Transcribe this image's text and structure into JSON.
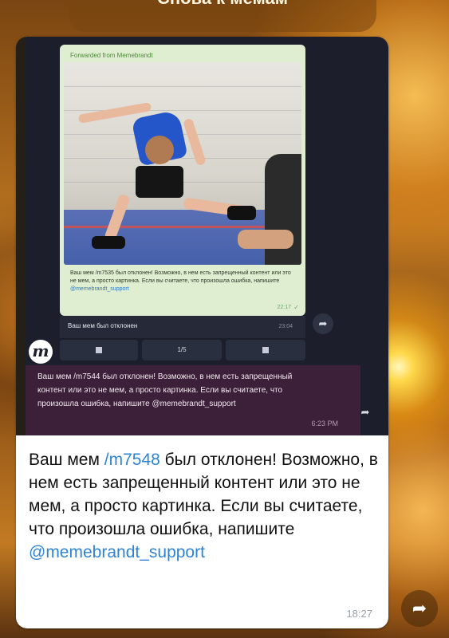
{
  "top_button": {
    "label": "Снова к мемам"
  },
  "screenshot": {
    "forwarded_label": "Forwarded from Memebrandt",
    "photo_caption": {
      "pre": "Ваш мем ",
      "cmd": "/m7535",
      "mid": " был отклонен! Возможно, в нем есть запрещенный контент или это не мем, а просто картинка. Если вы считаете, что произошла ошибка, напишите ",
      "handle": "@memebrandt_support",
      "time": "22:17"
    },
    "bot_message": {
      "text": "Ваш мем был отклонен",
      "time": "23:04"
    },
    "pager": {
      "page": "1/5"
    },
    "rejection": {
      "text": "Ваш мем /m7544 был отклонен! Возможно, в нем есть запрещенный контент или это не мем, а просто картинка. Если вы считаете, что произошла ошибка, напишите @memebrandt_support",
      "time": "6:23 PM"
    }
  },
  "message": {
    "pre": "Ваш мем ",
    "cmd": "/m7548",
    "post": " был отклонен! Возможно, в нем есть запрещенный контент или это не мем, а просто картинка. Если вы считаете, что произошла ошибка, напишите ",
    "handle": "@memebrandt_support",
    "time": "18:27"
  },
  "icons": {
    "share": "share-arrow-icon",
    "logo": "m-logo-icon",
    "prev": "prev-square-icon",
    "next": "next-square-icon"
  },
  "colors": {
    "link": "#2e84d6",
    "bubble": "#ffffff",
    "shot_bg": "#1c1f2b"
  }
}
